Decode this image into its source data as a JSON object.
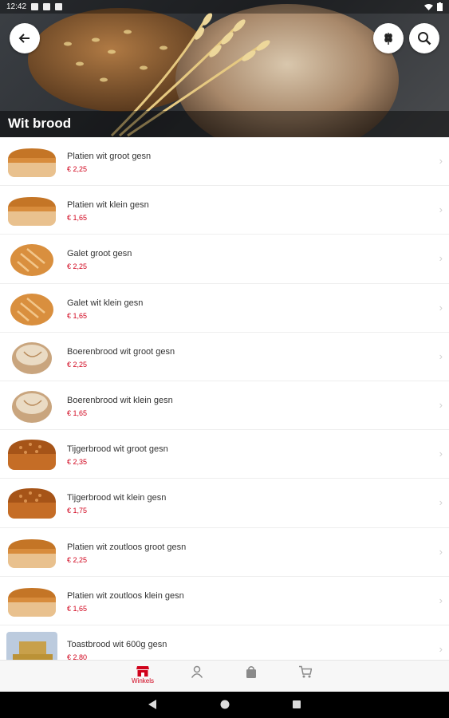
{
  "status": {
    "time": "12:42"
  },
  "header": {
    "title": "Wit brood",
    "back_icon": "arrow-left-icon",
    "grain_icon": "wheat-icon",
    "search_icon": "search-icon"
  },
  "products": [
    {
      "name": "Platien wit groot gesn",
      "price": "€ 2,25",
      "thumb": "loaf"
    },
    {
      "name": "Platien wit klein gesn",
      "price": "€ 1,65",
      "thumb": "loaf"
    },
    {
      "name": "Galet groot gesn",
      "price": "€ 2,25",
      "thumb": "round"
    },
    {
      "name": "Galet wit klein gesn",
      "price": "€ 1,65",
      "thumb": "round"
    },
    {
      "name": "Boerenbrood wit groot gesn",
      "price": "€ 2,25",
      "thumb": "farm"
    },
    {
      "name": "Boerenbrood wit klein gesn",
      "price": "€ 1,65",
      "thumb": "farm"
    },
    {
      "name": "Tijgerbrood wit groot gesn",
      "price": "€ 2,35",
      "thumb": "tiger"
    },
    {
      "name": "Tijgerbrood wit klein gesn",
      "price": "€ 1,75",
      "thumb": "tiger"
    },
    {
      "name": "Platien wit zoutloos groot gesn",
      "price": "€ 2,25",
      "thumb": "loaf"
    },
    {
      "name": "Platien wit zoutloos klein gesn",
      "price": "€ 1,65",
      "thumb": "loaf"
    },
    {
      "name": "Toastbrood wit 600g gesn",
      "price": "€ 2,80",
      "thumb": "toast"
    }
  ],
  "tabs": [
    {
      "label": "Winkels",
      "icon": "store-icon",
      "active": true
    },
    {
      "label": "",
      "icon": "user-icon",
      "active": false
    },
    {
      "label": "",
      "icon": "bag-icon",
      "active": false
    },
    {
      "label": "",
      "icon": "cart-icon",
      "active": false
    }
  ],
  "colors": {
    "accent": "#d0021b",
    "tab_inactive": "#8a8a8a"
  }
}
